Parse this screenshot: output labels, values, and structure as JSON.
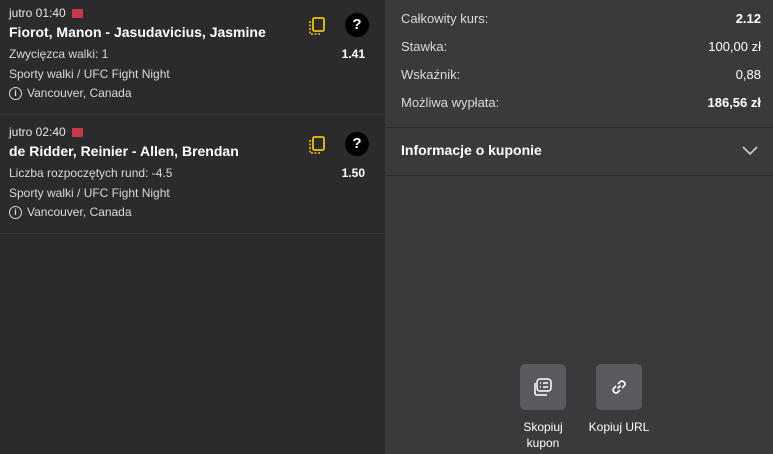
{
  "bets": [
    {
      "time": "jutro 01:40",
      "title": "Fiorot, Manon - Jasudavicius, Jasmine",
      "market": "Zwycięzca walki: 1",
      "odds": "1.41",
      "sport": "Sporty walki / UFC Fight Night",
      "venue": "Vancouver, Canada"
    },
    {
      "time": "jutro 02:40",
      "title": "de Ridder, Reinier - Allen, Brendan",
      "market": "Liczba rozpoczętych rund: -4.5",
      "odds": "1.50",
      "sport": "Sporty walki / UFC Fight Night",
      "venue": "Vancouver, Canada"
    }
  ],
  "summary": {
    "total_odds_label": "Całkowity kurs:",
    "total_odds_value": "2.12",
    "stake_label": "Stawka:",
    "stake_value": "100,00 zł",
    "index_label": "Wskaźnik:",
    "index_value": "0,88",
    "payout_label": "Możliwa wypłata:",
    "payout_value": "186,56 zł"
  },
  "coupon_info": {
    "label": "Informacje o kuponie"
  },
  "actions": {
    "copy_coupon_line1": "Skopiuj",
    "copy_coupon_line2": "kupon",
    "copy_url": "Kopiuj URL"
  },
  "colors": {
    "accent_yellow": "#f2c300",
    "flag_red": "#c8384a",
    "left_bg": "#2b2b2e",
    "right_bg": "#3a3a3d",
    "button_bg": "#5a5a5e"
  }
}
